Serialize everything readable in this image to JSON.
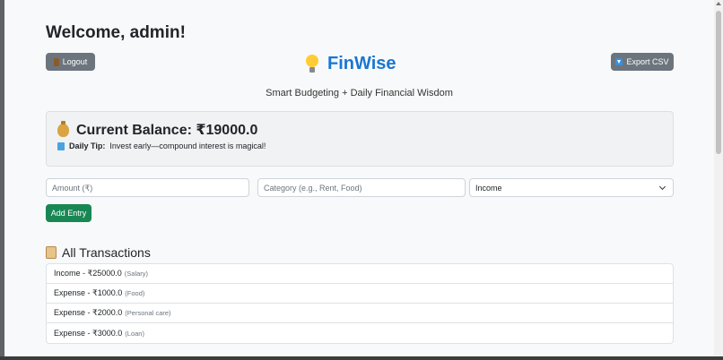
{
  "header": {
    "welcome": "Welcome, admin!",
    "logout_label": "Logout",
    "export_label": "Export CSV",
    "brand_name": "FinWise",
    "tagline": "Smart Budgeting + Daily Financial Wisdom"
  },
  "balance": {
    "label": "Current Balance: ₹19000.0",
    "tip_label": "Daily Tip:",
    "tip_text": "Invest early—compound interest is magical!"
  },
  "form": {
    "amount_placeholder": "Amount (₹)",
    "category_placeholder": "Category (e.g., Rent, Food)",
    "type_selected": "Income",
    "add_label": "Add Entry"
  },
  "transactions": {
    "title": "All Transactions",
    "items": [
      {
        "text": "Income - ₹25000.0",
        "category": "(Salary)"
      },
      {
        "text": "Expense - ₹1000.0",
        "category": "(Food)"
      },
      {
        "text": "Expense - ₹2000.0",
        "category": "(Personal care)"
      },
      {
        "text": "Expense - ₹3000.0",
        "category": "(Loan)"
      }
    ]
  },
  "icons": {
    "logout": "door-icon",
    "export": "download-icon",
    "brand": "lightbulb-icon",
    "balance": "money-bag-icon",
    "tip": "book-icon",
    "transactions": "scroll-icon"
  },
  "colors": {
    "brand": "#1976d2",
    "secondary_button": "#6c757d",
    "success_button": "#198754"
  }
}
